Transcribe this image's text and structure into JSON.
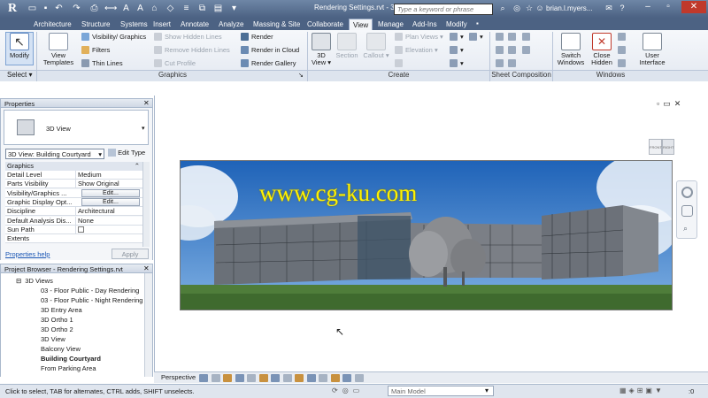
{
  "app": {
    "doc_title": "Rendering Settings.rvt - 3D View: ...",
    "search_placeholder": "Type a keyword or phrase",
    "username": "brian.l.myers...",
    "colors": {
      "title_bar": "#4c6283",
      "ribbon": "#eef2f7",
      "accent_link": "#1a56b4",
      "watermark": "#fff200"
    }
  },
  "tabs": [
    "Architecture",
    "Structure",
    "Systems",
    "Insert",
    "Annotate",
    "Analyze",
    "Massing & Site",
    "Collaborate",
    "View",
    "Manage",
    "Add-Ins",
    "Modify"
  ],
  "active_tab": "View",
  "ribbon": {
    "modify": "Modify",
    "select": "Select",
    "view_templates": [
      "View",
      "Templates"
    ],
    "graphics_items": [
      "Visibility/ Graphics",
      "Filters",
      "Thin Lines"
    ],
    "graphics_disabled": [
      "Show Hidden Lines",
      "Remove Hidden Lines",
      "Cut Profile"
    ],
    "render_items": [
      "Render",
      "Render in Cloud",
      "Render Gallery"
    ],
    "create_3d": [
      "3D",
      "View"
    ],
    "section": "Section",
    "callout": "Callout",
    "plan_views": "Plan Views",
    "elevation": "Elevation",
    "switch_windows": [
      "Switch",
      "Windows"
    ],
    "close_hidden": [
      "Close",
      "Hidden"
    ],
    "user_interface": [
      "User",
      "Interface"
    ],
    "panels": {
      "graphics": "Graphics",
      "create": "Create",
      "sheet_composition": "Sheet Composition",
      "windows": "Windows"
    }
  },
  "properties": {
    "header": "Properties",
    "type_name": "3D View",
    "selector": "3D View: Building Courtyard",
    "edit_type": "Edit Type",
    "group": "Graphics",
    "rows": [
      {
        "k": "Detail Level",
        "v": "Medium"
      },
      {
        "k": "Parts Visibility",
        "v": "Show Original"
      },
      {
        "k": "Visibility/Graphics ...",
        "v": "Edit...",
        "btn": true
      },
      {
        "k": "Graphic Display Opt...",
        "v": "Edit...",
        "btn": true
      },
      {
        "k": "Discipline",
        "v": "Architectural"
      },
      {
        "k": "Default Analysis Dis...",
        "v": "None"
      },
      {
        "k": "Sun Path",
        "v": ""
      },
      {
        "k": "Extents",
        "v": ""
      }
    ],
    "help": "Properties help",
    "apply": "Apply"
  },
  "project_browser": {
    "header": "Project Browser - Rendering Settings.rvt",
    "items": [
      {
        "label": "3D Views",
        "level": 1,
        "toggle": "⊟"
      },
      {
        "label": "03 - Floor Public - Day Rendering",
        "level": 2
      },
      {
        "label": "03 - Floor Public - Night Rendering",
        "level": 2
      },
      {
        "label": "3D Entry Area",
        "level": 2
      },
      {
        "label": "3D Ortho 1",
        "level": 2
      },
      {
        "label": "3D Ortho 2",
        "level": 2
      },
      {
        "label": "3D View",
        "level": 2
      },
      {
        "label": "Balcony View",
        "level": 2
      },
      {
        "label": "Building Courtyard",
        "level": 2,
        "bold": true
      },
      {
        "label": "From Parking Area",
        "level": 2
      }
    ]
  },
  "view": {
    "watermark": "www.cg-ku.com",
    "viewcube_labels": [
      "FRONT",
      "RIGHT"
    ],
    "control_label": "Perspective"
  },
  "status": {
    "text": "Click to select, TAB for alternates, CTRL adds, SHIFT unselects.",
    "model": "Main Model",
    "filter_count": ":0"
  }
}
